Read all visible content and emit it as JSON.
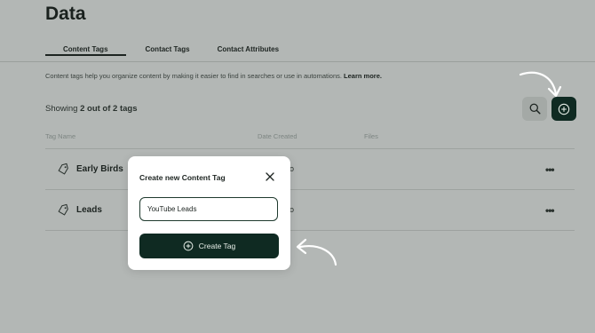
{
  "page": {
    "title": "Data"
  },
  "tabs": [
    {
      "label": "Content Tags",
      "active": true
    },
    {
      "label": "Contact Tags",
      "active": false
    },
    {
      "label": "Contact Attributes",
      "active": false
    }
  ],
  "description": {
    "text": "Content tags help you organize content by making it easier to find in searches or use in automations.",
    "link": "Learn more."
  },
  "summary": {
    "prefix": "Showing ",
    "count": "2 out of 2 tags"
  },
  "table": {
    "columns": [
      "Tag Name",
      "Date Created",
      "Files"
    ],
    "rows": [
      {
        "name": "Early Birds",
        "date_fragment": "o",
        "menu": "•••"
      },
      {
        "name": "Leads",
        "date_fragment": "o",
        "menu": "•••"
      }
    ]
  },
  "modal": {
    "title": "Create new Content Tag",
    "input_value": "YouTube Leads",
    "button_label": "Create Tag"
  },
  "icons": {
    "search": "search-icon",
    "add": "plus-circle-icon",
    "tag": "tag-icon",
    "close": "close-icon"
  },
  "colors": {
    "background": "#b3b7b5",
    "primary_dark": "#0f2a22",
    "accent_light": "#e8efe9"
  }
}
